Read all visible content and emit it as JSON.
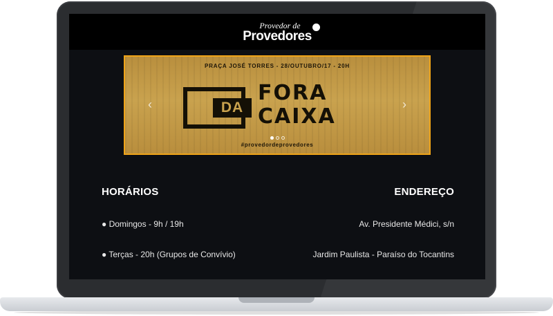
{
  "header": {
    "logo_top": "Provedor de",
    "logo_main": "Provedores"
  },
  "carousel": {
    "event_line": "PRAÇA JOSÉ TORRES - 28/OUTUBRO/17 - 20H",
    "title_da": "DA",
    "title_fora": "FORA",
    "title_caixa": "CAIXA",
    "hashtag": "#provedordeprovedores",
    "prev_icon": "‹",
    "next_icon": "›",
    "slide_count": 3,
    "active_slide": 1,
    "border_color": "#f0a418"
  },
  "horarios": {
    "title": "HORÁRIOS",
    "items": [
      "● Domingos - 9h / 19h",
      "● Terças - 20h (Grupos de Convívio)"
    ]
  },
  "endereco": {
    "title": "ENDEREÇO",
    "lines": [
      "Av. Presidente Médici, s/n",
      "Jardim Paulista - Paraíso do Tocantins"
    ]
  }
}
